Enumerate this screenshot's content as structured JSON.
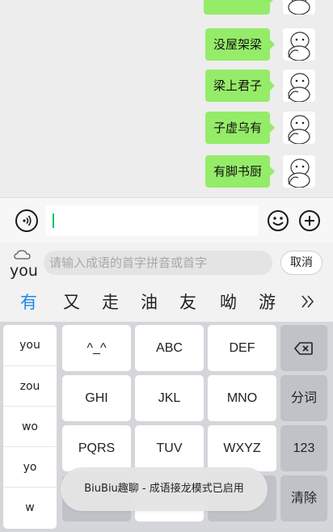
{
  "chat": {
    "messages": [
      {
        "text": "没屋架梁"
      },
      {
        "text": "梁上君子"
      },
      {
        "text": "子虚乌有"
      },
      {
        "text": "有脚书厨"
      }
    ]
  },
  "input_bar": {
    "voice_icon": "voice-icon",
    "emoji_icon": "emoji-icon",
    "plus_icon": "plus-icon",
    "text_value": ""
  },
  "idiom_search": {
    "pinyin": "you",
    "placeholder": "请输入成语的首字拼音或首字",
    "cancel_label": "取消"
  },
  "candidates": {
    "items": [
      "有",
      "又",
      "走",
      "油",
      "友",
      "呦",
      "游"
    ],
    "expand_icon": "double-chevron-right-icon"
  },
  "keyboard": {
    "pinyin_column": [
      "you",
      "zou",
      "wo",
      "yo",
      "w"
    ],
    "rows": [
      [
        "^_^",
        "ABC",
        "DEF"
      ],
      [
        "GHI",
        "JKL",
        "MNO"
      ],
      [
        "PQRS",
        "TUV",
        "WXYZ"
      ]
    ],
    "backspace_icon": "backspace-icon",
    "segment_label": "分词",
    "numbers_label": "123",
    "clear_label": "清除"
  },
  "toast": {
    "text": "BiuBiu趣聊 - 成语接龙模式已启用"
  },
  "colors": {
    "bubble": "#95ec69",
    "accent_candidate": "#1e88e5",
    "caret": "#07c160"
  }
}
